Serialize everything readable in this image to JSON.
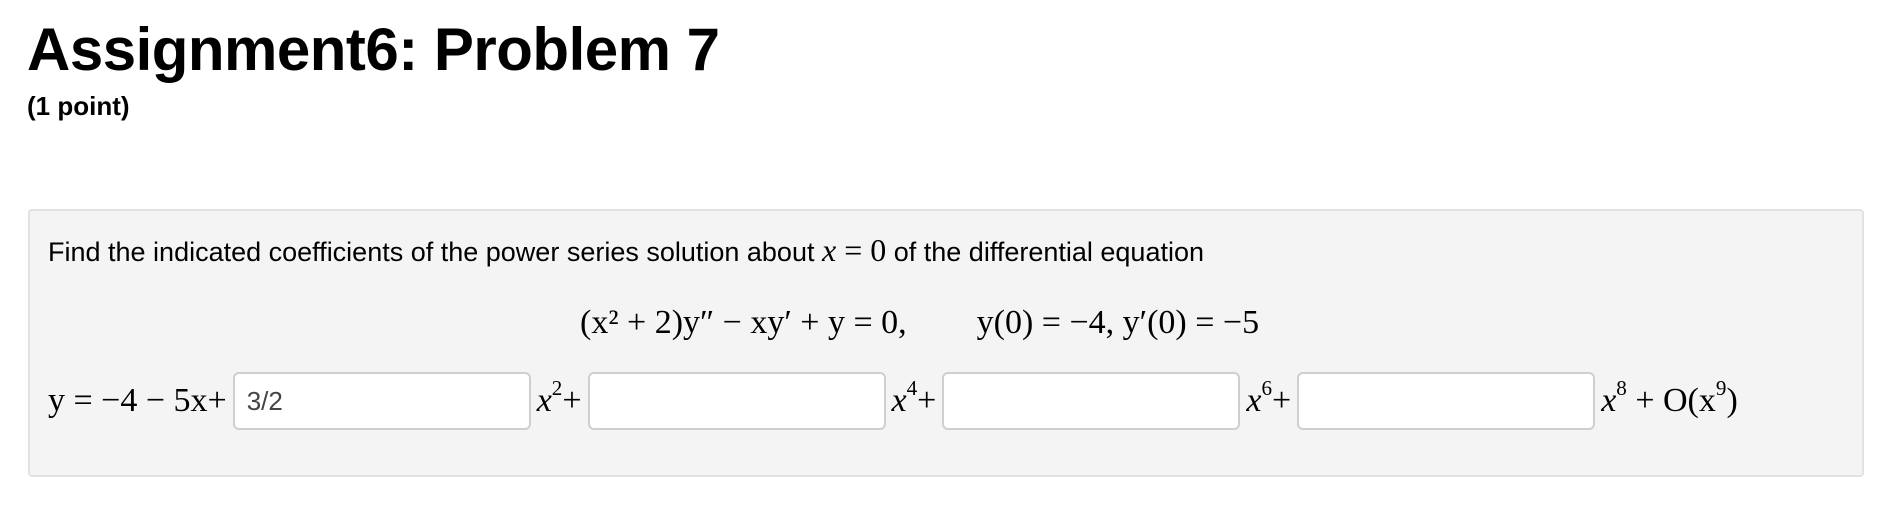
{
  "header": {
    "title": "Assignment6: Problem 7",
    "points": "(1 point)"
  },
  "problem": {
    "prompt_before": "Find the indicated coefficients of the power series solution about",
    "prompt_math_var": "x",
    "prompt_math_rest": " = 0",
    "prompt_after": "of the differential equation",
    "equation_lhs": "(x² + 2)y″ − xy′ + y = 0,",
    "initial_conditions": "y(0) = −4, y′(0) = −5",
    "series": {
      "lead_prefix": "y = −4 − 5x+",
      "term1_suffix_base": "x",
      "term1_exp": "2",
      "term2_suffix_base": "x",
      "term2_exp": "4",
      "term3_suffix_base": "x",
      "term3_exp": "6",
      "term4_suffix_base": "x",
      "term4_exp": "8",
      "tail_big_o": "+ O(x",
      "tail_exp": "9",
      "tail_close": ")",
      "plus": "+"
    },
    "inputs": [
      {
        "value": "3/2"
      },
      {
        "value": ""
      },
      {
        "value": ""
      },
      {
        "value": ""
      }
    ]
  }
}
